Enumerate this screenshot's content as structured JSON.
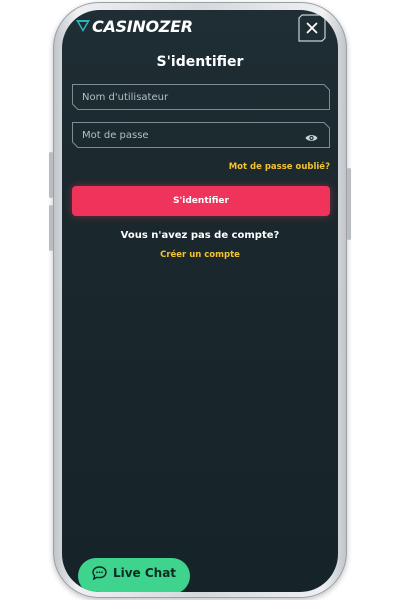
{
  "app": {
    "logo_text": "CASINOZER"
  },
  "login": {
    "title": "S'identifier",
    "username_placeholder": "Nom d'utilisateur",
    "password_placeholder": "Mot de passe",
    "forgot_password": "Mot de passe oublié?",
    "submit_label": "S'identifier",
    "no_account_text": "Vous n'avez pas de compte?",
    "create_account": "Créer un compte"
  },
  "chat": {
    "label": "Live Chat"
  },
  "colors": {
    "background": "#1c2a30",
    "accent_red": "#f0335a",
    "link_yellow": "#f2c230",
    "chat_green": "#3ed48e"
  },
  "icons": {
    "close": "close-icon",
    "password_toggle": "eye-icon",
    "chat": "chat-bubble-icon",
    "logo_mark": "logo-mark-icon"
  }
}
